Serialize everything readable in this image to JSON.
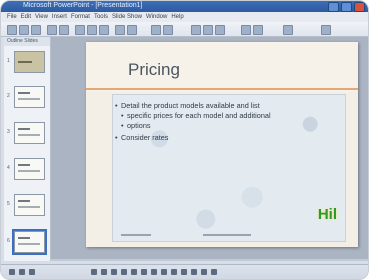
{
  "window": {
    "title": "Microsoft PowerPoint - [Presentation1]",
    "accent": "#2e5aa0"
  },
  "menu": [
    "File",
    "Edit",
    "View",
    "Insert",
    "Format",
    "Tools",
    "Slide Show",
    "Window",
    "Help"
  ],
  "thumbnails": {
    "tabs": "Outline  Slides",
    "items": [
      "1",
      "2",
      "3",
      "4",
      "5",
      "6"
    ],
    "selected_index": 6
  },
  "slide": {
    "title": "Pricing",
    "bullets": [
      "Detail the product models available and list",
      "specific prices for each model and additional",
      "options",
      "Consider rates"
    ],
    "logo_text": "Hil"
  },
  "colors": {
    "title_rule": "#e2a878",
    "logo": "#2c9a2c"
  }
}
